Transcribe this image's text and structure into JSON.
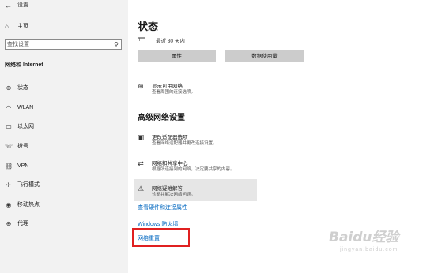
{
  "window": {
    "title": "设置",
    "back_icon": "back-arrow-icon"
  },
  "sidebar": {
    "home_label": "主页",
    "home_icon": "home-icon",
    "search_placeholder": "查找设置",
    "search_icon": "search-icon",
    "section_title": "网络和 Internet",
    "items": [
      {
        "label": "状态",
        "icon": "globe-status-icon"
      },
      {
        "label": "WLAN",
        "icon": "wifi-icon"
      },
      {
        "label": "以太网",
        "icon": "ethernet-icon"
      },
      {
        "label": "拨号",
        "icon": "phone-dialup-icon"
      },
      {
        "label": "VPN",
        "icon": "vpn-icon"
      },
      {
        "label": "飞行模式",
        "icon": "airplane-icon"
      },
      {
        "label": "移动热点",
        "icon": "hotspot-icon"
      },
      {
        "label": "代理",
        "icon": "proxy-globe-icon"
      }
    ]
  },
  "main": {
    "title": "状态",
    "network_subtitle": "最近 30 天内",
    "buttons": {
      "properties": "属性",
      "data_usage": "数据使用量"
    },
    "show_networks": {
      "title": "显示可用网络",
      "desc": "查看周围的连接选项。"
    },
    "advanced_title": "高级网络设置",
    "adapter_options": {
      "title": "更改适配器选项",
      "desc": "查看网络适配器并更改连接设置。"
    },
    "sharing_center": {
      "title": "网络和共享中心",
      "desc": "根据所连接到的网络，决定要共享的内容。"
    },
    "troubleshooter": {
      "title": "网络疑难解答",
      "desc": "诊断并解决网络问题。"
    },
    "links": {
      "hardware_props": "查看硬件和连接属性",
      "firewall": "Windows 防火墙",
      "network_reset": "网络重置"
    }
  },
  "watermark": {
    "line1": "Baidu经验",
    "line2": "jingyan.baidu.com"
  },
  "colors": {
    "sidebar_bg": "#f2f2f2",
    "link": "#0067c0",
    "button_bg": "#cccccc",
    "highlight": "#e02020"
  }
}
